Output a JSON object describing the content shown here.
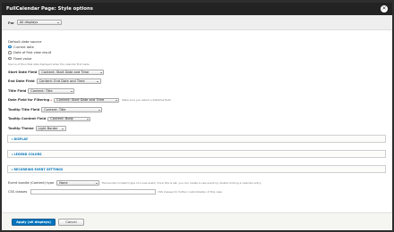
{
  "dialog": {
    "title": "FullCalendar Page: Style options",
    "close_glyph": "✕"
  },
  "scope": {
    "label": "For",
    "value": "All displays"
  },
  "date_source": {
    "label": "Default date source",
    "options": [
      "Current date",
      "Date of first view result",
      "Fixed value"
    ],
    "selected": "Current date",
    "description": "Source of the initial date displayed when the calendar first loads."
  },
  "fields": {
    "start_label": "Start Date Field",
    "start_value": "Content: Start Date and Time",
    "end_label": "End Date Field",
    "end_value": "Content: End Date and Time",
    "title_label": "Title Field",
    "title_value": "Content: Title",
    "filter_label": "Date Field for Filtering",
    "filter_required": "*",
    "filter_value": "Content: Start Date and Time",
    "filter_hint": "Make sure you select a datetime field.",
    "tooltip_title_label": "Tooltip Title Field",
    "tooltip_title_value": "Content: Title",
    "tooltip_content_label": "Tooltip Content Field",
    "tooltip_content_value": "Content: Body",
    "tooltip_theme_label": "Tooltip Theme",
    "tooltip_theme_value": "Light Border"
  },
  "sections": {
    "display": "DISPLAY",
    "legend_colors": "LEGEND COLORS",
    "recurring": "RECURRING EVENT SETTINGS"
  },
  "bundle": {
    "label": "Event bundle (Content) type",
    "value": "None",
    "hint": "The bundle (content) type of a new event. Once this is set, you can create a new event by double clicking a calendar entry."
  },
  "css": {
    "label": "CSS classes",
    "value": "",
    "hint": "CSS classes for further customization of this view."
  },
  "footer": {
    "apply_label": "Apply (all displays)",
    "cancel_label": "Cancel"
  }
}
